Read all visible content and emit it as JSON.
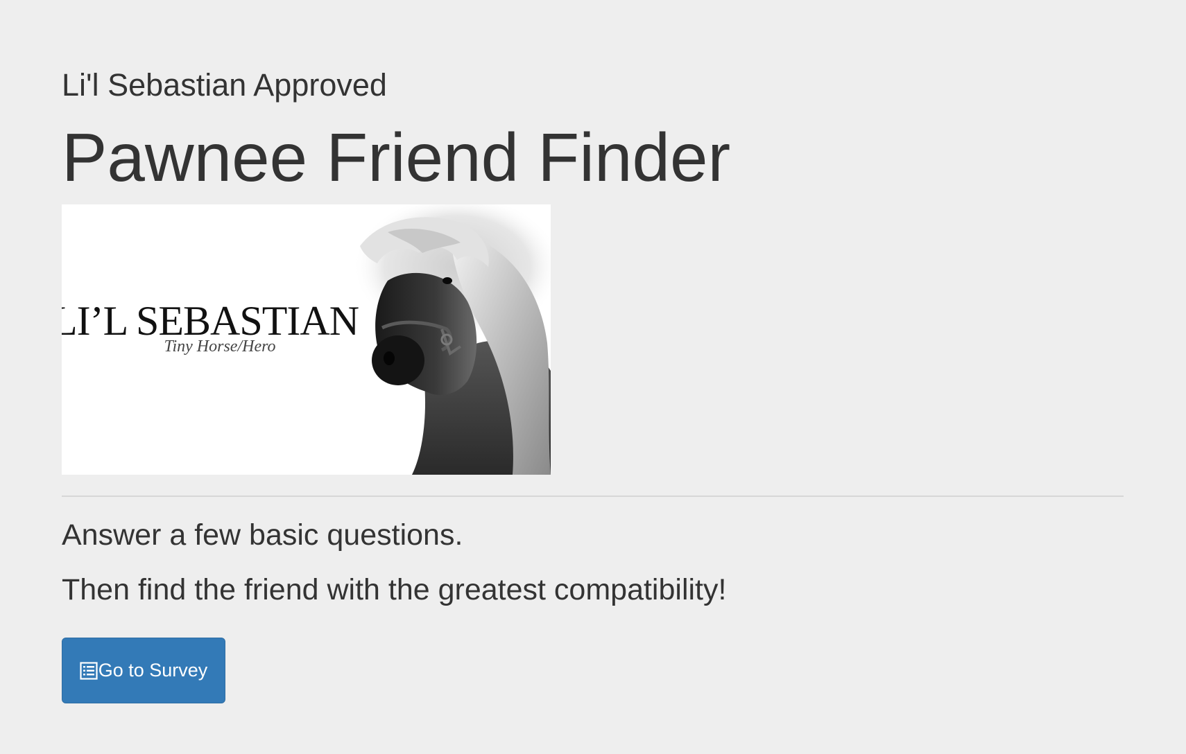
{
  "header": {
    "subtitle": "Li'l Sebastian Approved",
    "title": "Pawnee Friend Finder"
  },
  "hero_image": {
    "logo_text": "LI’L SEBASTIAN",
    "tagline": "Tiny Horse/Hero"
  },
  "body": {
    "line_1": "Answer a few basic questions.",
    "line_2": "Then find the friend with the greatest compatibility!"
  },
  "survey_button": {
    "label": "Go to Survey",
    "icon": "list-alt-icon"
  },
  "colors": {
    "background": "#eeeeee",
    "text": "#333333",
    "button": "#337ab7",
    "button_text": "#ffffff"
  }
}
